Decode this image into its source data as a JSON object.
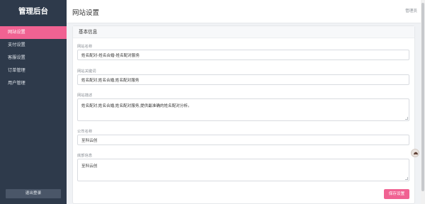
{
  "sidebar": {
    "brand": "管理后台",
    "items": [
      {
        "label": "网站设置",
        "active": true
      },
      {
        "label": "支付设置"
      },
      {
        "label": "客服设置"
      },
      {
        "label": "订单管理"
      },
      {
        "label": "用户管理"
      }
    ],
    "logout_label": "退出登录"
  },
  "header": {
    "title": "网站设置",
    "admin_label": "管理员"
  },
  "card": {
    "title": "基本信息",
    "fields": {
      "site_name": {
        "label": "网站名称",
        "value": "姓名配对-姓名合婚-姓名配对服务"
      },
      "keywords": {
        "label": "网站关键词",
        "value": "姓名配对,姓名合婚,姓名配对服务"
      },
      "description": {
        "label": "网站描述",
        "value": "姓名配对,姓名合婚,姓名配对服务,提供最准确的姓名配对分析。"
      },
      "company": {
        "label": "公司名称",
        "value": "至科云创"
      },
      "footer": {
        "label": "底部信息",
        "value": "至科云创"
      }
    },
    "save_label": "保存设置"
  },
  "colors": {
    "accent": "#f06292",
    "sidebar_bg": "#2e3a4b"
  }
}
